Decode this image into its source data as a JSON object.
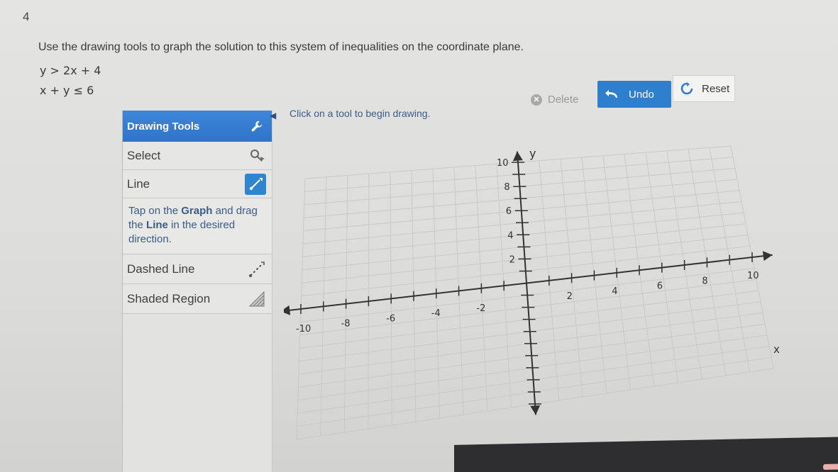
{
  "question": {
    "number": "4",
    "prompt": "Use the drawing tools to graph the solution to this system of inequalities on the coordinate plane.",
    "inequalities": [
      "y > 2x + 4",
      "x + y ≤ 6"
    ]
  },
  "tools": {
    "header": "Drawing Tools",
    "select_label": "Select",
    "line_label": "Line",
    "hint_parts": [
      "Tap on the ",
      "Graph",
      " and drag the ",
      "Line",
      " in the desired direction."
    ],
    "dashed_line_label": "Dashed Line",
    "shaded_region_label": "Shaded Region",
    "icons": {
      "header": "wrench-icon",
      "select": "magnifier-pointer-icon",
      "line": "line-tool-icon",
      "dashed": "dashed-line-icon",
      "shaded": "shaded-region-icon"
    }
  },
  "status_text": "Click on a tool to begin drawing.",
  "actions": {
    "delete_label": "Delete",
    "undo_label": "Undo",
    "reset_label": "Reset"
  },
  "graph": {
    "x_axis_label": "x",
    "y_axis_label": "y",
    "x_tick_labels": [
      "-10",
      "-8",
      "-6",
      "-4",
      "-2",
      "2",
      "4",
      "6",
      "8",
      "10"
    ],
    "y_tick_labels": [
      "2",
      "4",
      "6",
      "8",
      "10"
    ],
    "range": [
      -10,
      10
    ]
  },
  "colors": {
    "accent": "#2f7fcf",
    "header": "#3380d2",
    "hint_text": "#3a5c8a"
  }
}
